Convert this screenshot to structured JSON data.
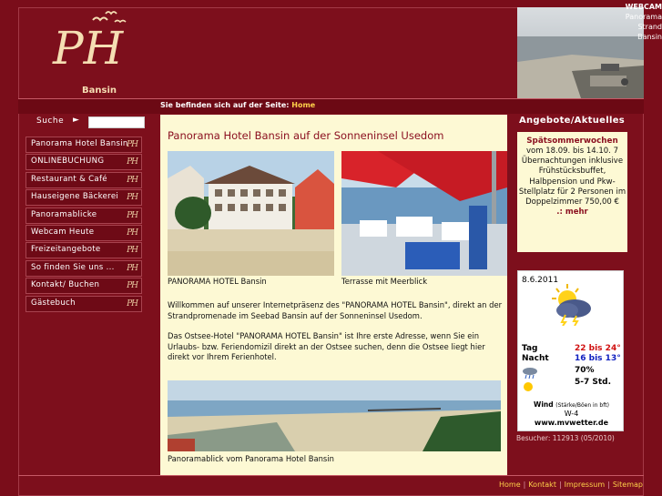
{
  "brand": {
    "logo_initials": "PH",
    "logo_sub": "Bansin",
    "gold": "#f5deb3",
    "bg": "#7d0f1c",
    "accent_yellow": "#ffd24a"
  },
  "webcam": {
    "title": "WEBCAM",
    "line1": "Panorama",
    "line2": "Strand",
    "line3": "Bansin"
  },
  "breadcrumb": {
    "prefix": "Sie befinden sich auf der Seite:",
    "current": "Home"
  },
  "search": {
    "label": "Suche",
    "arrow": "►",
    "placeholder": ""
  },
  "nav": {
    "items": [
      "Panorama Hotel Bansin",
      "ONLINEBUCHUNG",
      "Restaurant & Café",
      "Hauseigene Bäckerei",
      "Panoramablicke",
      "Webcam Heute",
      "Freizeitangebote",
      "So finden Sie uns ...",
      "Kontakt/ Buchen",
      "Gästebuch"
    ],
    "icon_text": "PH"
  },
  "main": {
    "title": "Panorama Hotel Bansin auf der Sonneninsel Usedom",
    "caption1": "PANORAMA HOTEL Bansin",
    "caption2": "Terrasse mit Meerblick",
    "para1": "Willkommen auf unserer Internetpräsenz des \"PANORAMA HOTEL Bansin\",  direkt an der Strandpromenade im Seebad Bansin auf der Sonneninsel Usedom.",
    "para2": "Das Ostsee-Hotel \"PANORAMA HOTEL Bansin\" ist Ihre erste Adresse, wenn Sie ein Urlaubs- bzw. Feriendomizil direkt an der Ostsee suchen, denn die Ostsee liegt hier direkt vor Ihrem Ferienhotel.",
    "caption3": "Panoramablick vom Panorama Hotel Bansin"
  },
  "offers": {
    "title": "Angebote/Aktuelles",
    "heading": "Spätsommerwochen",
    "text": "vom 18.09. bis 14.10. 7 Übernachtungen inklusive Frühstücksbuffet, Halbpension und Pkw-Stellplatz für 2 Personen im Doppelzimmer 750,00 €",
    "more": ".: mehr"
  },
  "weather": {
    "date": "8.6.2011",
    "day_label": "Tag",
    "day_value": "22 bis 24°",
    "night_label": "Nacht",
    "night_value": "16 bis 13°",
    "rain_value": "70%",
    "sun_value": "5-7 Std.",
    "wind_title": "Wind",
    "wind_unit": "(Stärke/Böen in bft)",
    "wind_value": "W-4",
    "source": "www.mvwetter.de",
    "color_day": "#d01010",
    "color_night": "#1020c0"
  },
  "visitors": "Besucher: 112913 (05/2010)",
  "footer": {
    "links": [
      "Home",
      "Kontakt",
      "Impressum",
      "Sitemap"
    ]
  }
}
